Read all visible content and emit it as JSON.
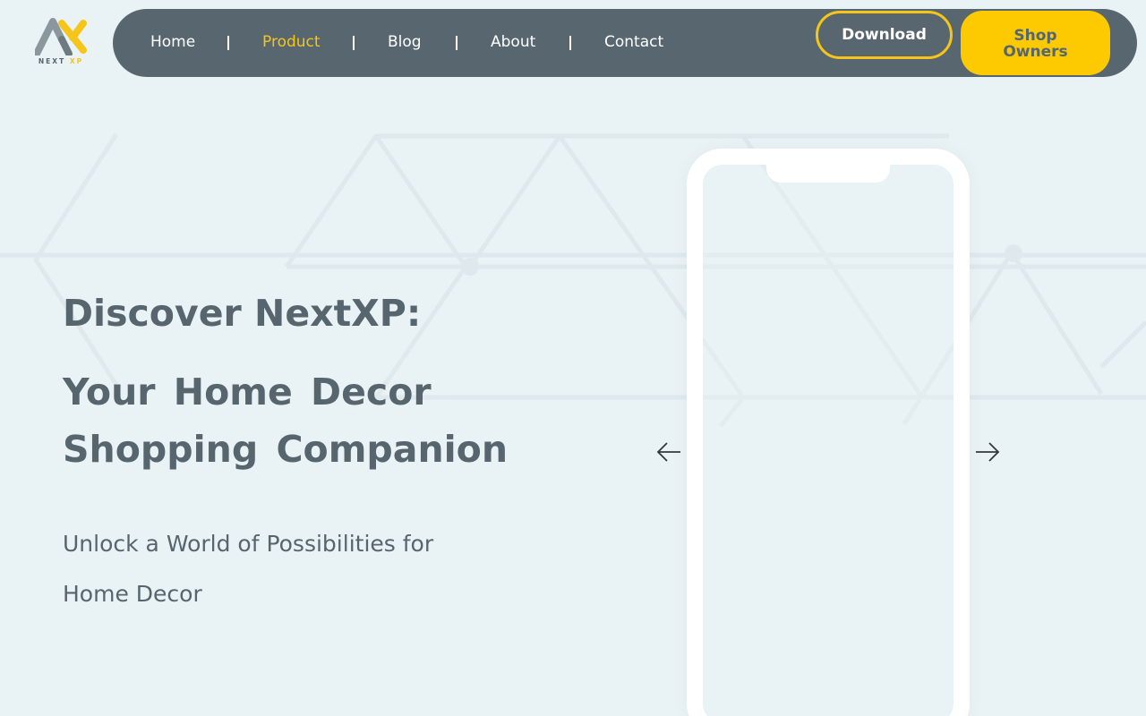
{
  "logo": {
    "text_main": "NEXT",
    "text_accent": "XP"
  },
  "nav": {
    "items": [
      {
        "label": "Home",
        "active": false
      },
      {
        "label": "Product",
        "active": true
      },
      {
        "label": "Blog",
        "active": false
      },
      {
        "label": "About",
        "active": false
      },
      {
        "label": "Contact",
        "active": false
      }
    ],
    "download_label": "Download",
    "shop_label_line1": "Shop",
    "shop_label_line2": "Owners"
  },
  "hero": {
    "title_prefix": "Discover ",
    "title_brand": "NextXP:",
    "title_line2": "Your Home Decor Shopping Companion",
    "subtitle": "Unlock a World of Possibilities for Home Decor"
  },
  "carousel": {
    "prev_icon": "arrow-left-icon",
    "next_icon": "arrow-right-icon"
  },
  "colors": {
    "background": "#e9f2f5",
    "navbar": "#58676f",
    "accent": "#fdca02",
    "text": "#56656e",
    "active_nav": "#f6c519"
  }
}
